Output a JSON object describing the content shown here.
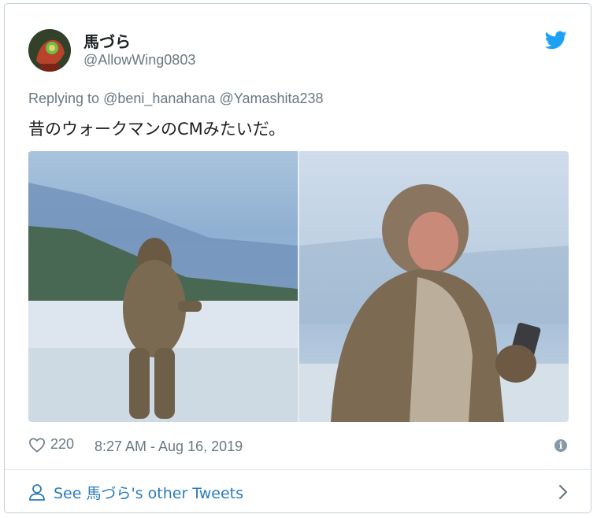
{
  "user": {
    "display_name": "馬づら",
    "handle": "@AllowWing0803"
  },
  "reply": {
    "prefix": "Replying to",
    "mentions": [
      "@beni_hanahana",
      "@Yamashita238"
    ]
  },
  "tweet": {
    "text": "昔のウォークマンのCMみたいだ。"
  },
  "footer": {
    "like_count": "220",
    "timestamp": "8:27 AM - Aug 16, 2019"
  },
  "see_more": {
    "label": "See 馬づら's other Tweets"
  },
  "colors": {
    "twitter_blue": "#1da1f2",
    "link_blue": "#2b7bb9",
    "meta_gray": "#697882",
    "text": "#1c2022",
    "border": "#c4cfd6"
  },
  "icons": {
    "brand": "twitter-bird-icon",
    "like": "heart-icon",
    "info": "info-icon",
    "person": "person-icon",
    "chevron": "chevron-right-icon"
  }
}
